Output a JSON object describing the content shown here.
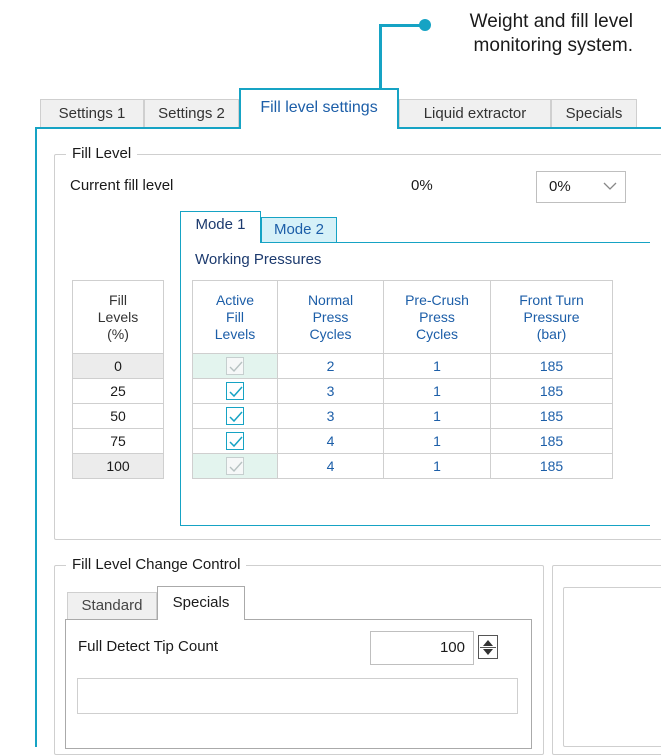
{
  "annotation": {
    "line1": "Weight and fill level",
    "line2": "monitoring system.",
    "accent_color": "#16a3c4"
  },
  "tabs": [
    {
      "label": "Settings 1",
      "active": false
    },
    {
      "label": "Settings 2",
      "active": false
    },
    {
      "label": "Fill level settings",
      "active": true
    },
    {
      "label": "Liquid extractor",
      "active": false
    },
    {
      "label": "Specials",
      "active": false
    }
  ],
  "fill_level": {
    "group_title": "Fill Level",
    "current_label": "Current fill level",
    "current_value": "0%",
    "dropdown_value": "0%",
    "dropdown_icon": "chevron-down-icon"
  },
  "mode_tabs": [
    {
      "label": "Mode 1",
      "active": true
    },
    {
      "label": "Mode 2",
      "active": false
    }
  ],
  "working_pressures": {
    "title": "Working Pressures",
    "fill_levels_header": [
      "Fill",
      "Levels",
      "(%)"
    ],
    "fill_levels": [
      "0",
      "25",
      "50",
      "75",
      "100"
    ],
    "headers": [
      [
        "Active",
        "Fill",
        "Levels"
      ],
      [
        "Normal",
        "Press",
        "Cycles"
      ],
      [
        "Pre-Crush",
        "Press",
        "Cycles"
      ],
      [
        "Front Turn",
        "Pressure",
        "(bar)"
      ]
    ],
    "rows": [
      {
        "active": true,
        "enabled": false,
        "normal": "2",
        "precrush": "1",
        "pressure": "185"
      },
      {
        "active": true,
        "enabled": true,
        "normal": "3",
        "precrush": "1",
        "pressure": "185"
      },
      {
        "active": true,
        "enabled": true,
        "normal": "3",
        "precrush": "1",
        "pressure": "185"
      },
      {
        "active": true,
        "enabled": true,
        "normal": "4",
        "precrush": "1",
        "pressure": "185"
      },
      {
        "active": true,
        "enabled": false,
        "normal": "4",
        "precrush": "1",
        "pressure": "185"
      }
    ]
  },
  "change_control": {
    "group_title": "Fill Level Change Control",
    "subtabs": [
      {
        "label": "Standard",
        "active": false
      },
      {
        "label": "Specials",
        "active": true
      }
    ],
    "full_detect_label": "Full Detect Tip Count",
    "full_detect_value": "100"
  }
}
